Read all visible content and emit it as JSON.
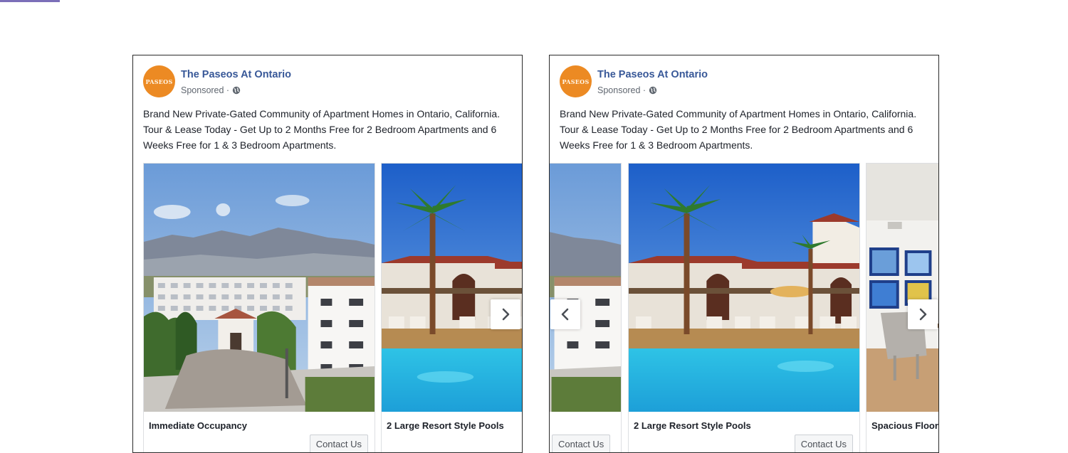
{
  "ads": [
    {
      "page_name": "The Paseos At Ontario",
      "avatar_text": "PASEOS",
      "sponsored": "Sponsored ·",
      "privacy_icon": "globe-icon",
      "body": "Brand New Private-Gated Community of Apartment Homes in Ontario, California. Tour & Lease Today - Get Up to 2 Months Free for 2 Bedroom Apartments and 6 Weeks Free for 1 & 3 Bedroom Apartments.",
      "cards": [
        {
          "photo": "building-mountains-photo",
          "caption": "Immediate Occupancy",
          "cta": "Contact Us"
        },
        {
          "photo": "resort-pool-photo",
          "caption": "2 Large Resort Style Pools"
        }
      ],
      "next_icon": "chevron-right-icon"
    },
    {
      "page_name": "The Paseos At Ontario",
      "avatar_text": "PASEOS",
      "sponsored": "Sponsored ·",
      "privacy_icon": "globe-icon",
      "body": "Brand New Private-Gated Community of Apartment Homes in Ontario, California. Tour & Lease Today - Get Up to 2 Months Free for 2 Bedroom Apartments and 6 Weeks Free for 1 & 3 Bedroom Apartments.",
      "cards": [
        {
          "photo": "building-mountains-photo",
          "cta": "Contact Us"
        },
        {
          "photo": "resort-pool-photo",
          "caption": "2 Large Resort Style Pools",
          "cta": "Contact Us"
        },
        {
          "photo": "interior-dining-photo",
          "caption": "Spacious Floor"
        }
      ],
      "prev_icon": "chevron-left-icon",
      "next_icon": "chevron-right-icon"
    }
  ],
  "colors": {
    "page_name": "#385898",
    "avatar": "#ec8a23",
    "meta": "#606770",
    "border": "#2a2a2a"
  }
}
